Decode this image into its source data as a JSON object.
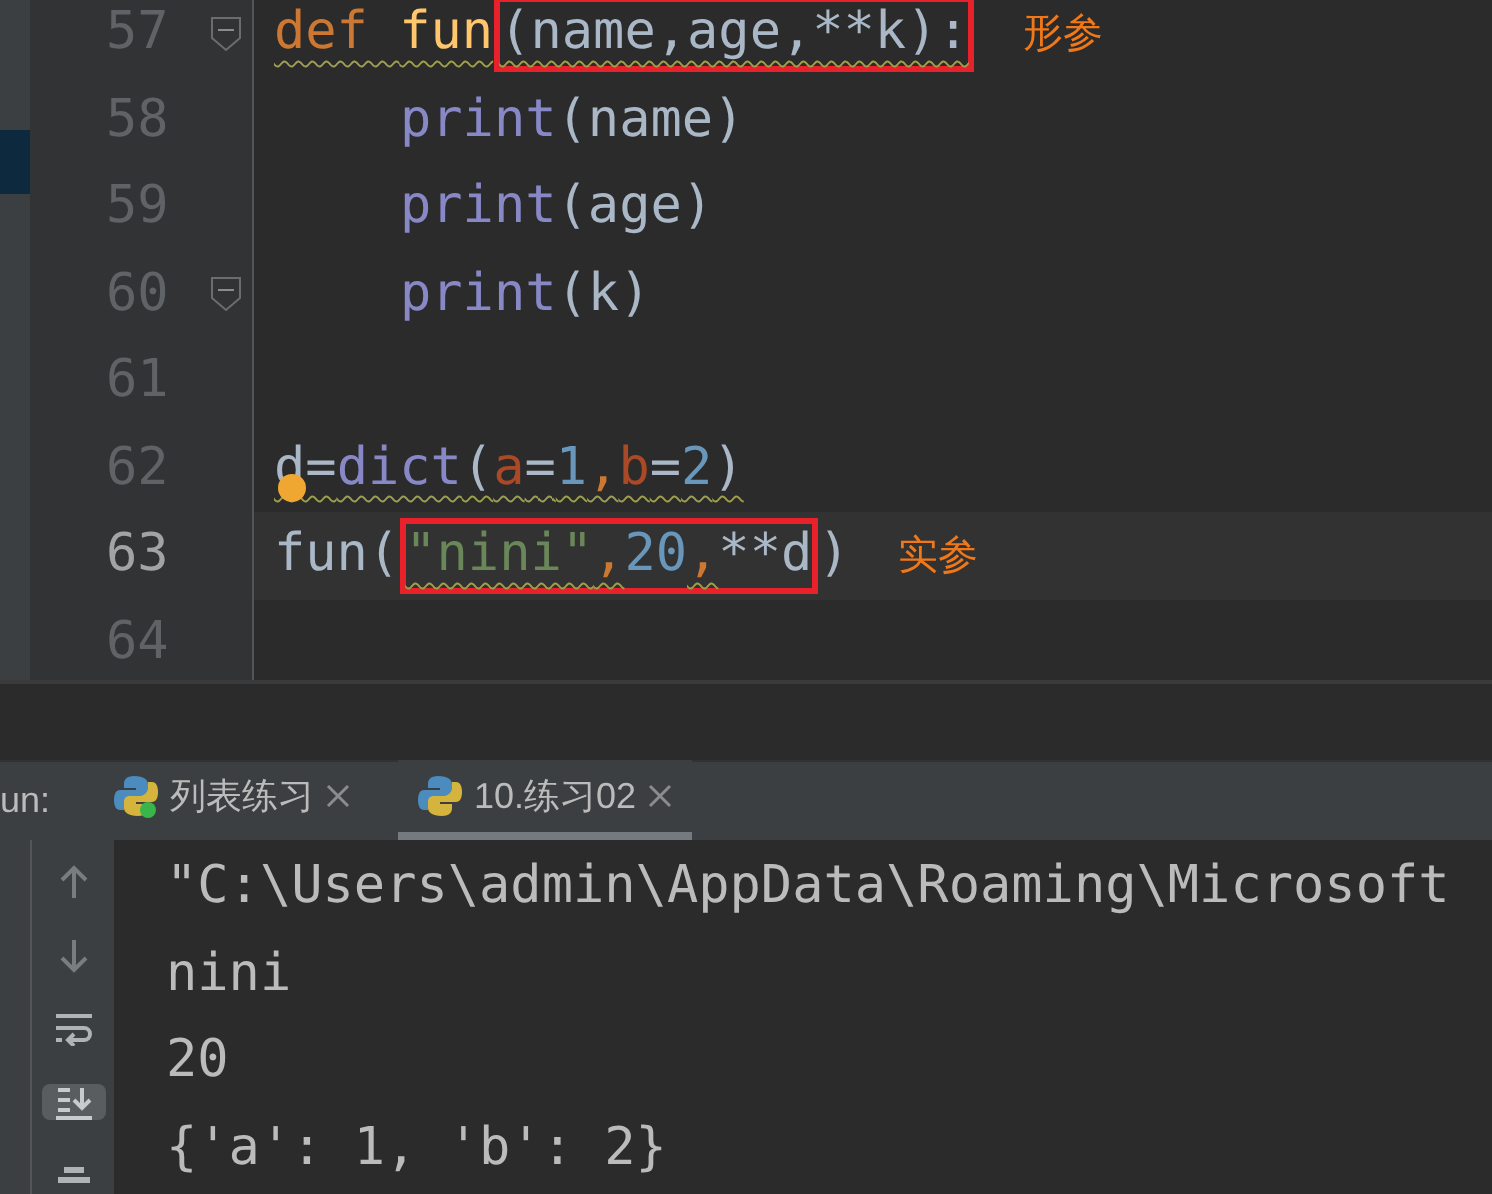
{
  "editor": {
    "lines": [
      {
        "number": "57",
        "current": false,
        "fold": true,
        "bulb": false,
        "indented": false,
        "annotation": "形参",
        "tokens": [
          {
            "text": "def ",
            "kind": "keyword",
            "squiggle": true,
            "boxed": false
          },
          {
            "text": "fun",
            "kind": "function",
            "squiggle": true,
            "boxed": false
          },
          {
            "text": "(name,age,**k):",
            "kind": "plain",
            "squiggle": true,
            "boxed": true
          }
        ]
      },
      {
        "number": "58",
        "current": false,
        "fold": false,
        "bulb": false,
        "indented": true,
        "tokens": [
          {
            "text": "print",
            "kind": "builtin",
            "squiggle": false,
            "boxed": false
          },
          {
            "text": "(name)",
            "kind": "plain",
            "squiggle": false,
            "boxed": false
          }
        ]
      },
      {
        "number": "59",
        "current": false,
        "fold": false,
        "bulb": false,
        "indented": true,
        "tokens": [
          {
            "text": "print",
            "kind": "builtin",
            "squiggle": false,
            "boxed": false
          },
          {
            "text": "(age)",
            "kind": "plain",
            "squiggle": false,
            "boxed": false
          }
        ]
      },
      {
        "number": "60",
        "current": false,
        "fold": true,
        "bulb": false,
        "indented": true,
        "tokens": [
          {
            "text": "print",
            "kind": "builtin",
            "squiggle": false,
            "boxed": false
          },
          {
            "text": "(k)",
            "kind": "plain",
            "squiggle": false,
            "boxed": false
          }
        ]
      },
      {
        "number": "61",
        "current": false,
        "fold": false,
        "bulb": false
      },
      {
        "number": "62",
        "current": false,
        "fold": false,
        "bulb": true,
        "indented": false,
        "tokens": [
          {
            "text": "d=",
            "kind": "plain",
            "squiggle": true,
            "boxed": false
          },
          {
            "text": "dict",
            "kind": "builtin",
            "squiggle": true,
            "boxed": false
          },
          {
            "text": "(",
            "kind": "plain",
            "squiggle": true,
            "boxed": false
          },
          {
            "text": "a",
            "kind": "param",
            "squiggle": true,
            "boxed": false
          },
          {
            "text": "=",
            "kind": "plain",
            "squiggle": true,
            "boxed": false
          },
          {
            "text": "1",
            "kind": "number",
            "squiggle": true,
            "boxed": false
          },
          {
            "text": ",",
            "kind": "keyword",
            "squiggle": true,
            "boxed": false
          },
          {
            "text": "b",
            "kind": "param",
            "squiggle": true,
            "boxed": false
          },
          {
            "text": "=",
            "kind": "plain",
            "squiggle": true,
            "boxed": false
          },
          {
            "text": "2",
            "kind": "number",
            "squiggle": true,
            "boxed": false
          },
          {
            "text": ")",
            "kind": "plain",
            "squiggle": true,
            "boxed": false
          }
        ]
      },
      {
        "number": "63",
        "current": true,
        "fold": false,
        "bulb": false,
        "indented": false,
        "annotation": "实参",
        "tokens": [
          {
            "text": "fun(",
            "kind": "plain",
            "squiggle": false,
            "boxed": false
          },
          {
            "text": "\"nini\"",
            "kind": "string",
            "squiggle": true,
            "boxed": true
          },
          {
            "text": ",",
            "kind": "keyword",
            "squiggle": true,
            "boxed": true
          },
          {
            "text": "20",
            "kind": "number",
            "squiggle": false,
            "boxed": true
          },
          {
            "text": ",",
            "kind": "keyword",
            "squiggle": true,
            "boxed": true
          },
          {
            "text": "**d",
            "kind": "plain",
            "squiggle": false,
            "boxed": true
          },
          {
            "text": ")",
            "kind": "plain",
            "squiggle": false,
            "boxed": false
          }
        ]
      },
      {
        "number": "64",
        "current": false,
        "fold": false,
        "bulb": false
      }
    ]
  },
  "run_panel": {
    "label": "un:",
    "tabs": [
      {
        "title": "列表练习",
        "selected": false,
        "running": true
      },
      {
        "title": "10.练习02",
        "selected": true,
        "running": false
      }
    ],
    "tools": [
      {
        "kind": "up",
        "selected": false
      },
      {
        "kind": "down",
        "selected": false
      },
      {
        "kind": "wrap",
        "selected": false
      },
      {
        "kind": "scroll-end",
        "selected": true
      },
      {
        "kind": "print",
        "selected": false
      }
    ],
    "output": [
      "\"C:\\Users\\admin\\AppData\\Roaming\\Microsoft",
      "nini",
      "20",
      "{'a': 1, 'b': 2}"
    ]
  }
}
